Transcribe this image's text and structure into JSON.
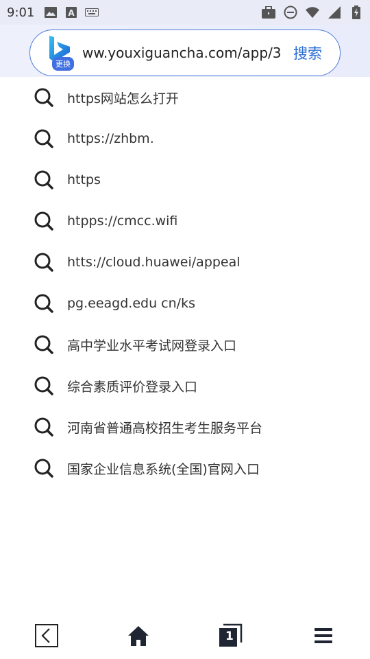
{
  "status_bar": {
    "time": "9:01",
    "left_icons": [
      "image-icon",
      "font-icon",
      "keyboard-icon"
    ],
    "right_icons": [
      "briefcase-icon",
      "do-not-disturb-icon",
      "wifi-icon",
      "signal-icon",
      "battery-charging-icon"
    ]
  },
  "search": {
    "engine_badge": "更换",
    "url": "ww.youxiguancha.com/app/3",
    "button_label": "搜索"
  },
  "suggestions": [
    {
      "label": "https网站怎么打开"
    },
    {
      "label": "https://zhbm."
    },
    {
      "label": "https"
    },
    {
      "label": "htpps://cmcc.wifi"
    },
    {
      "label": "htts://cloud.huawei/appeal"
    },
    {
      "label": "pg.eeagd.edu cn/ks"
    },
    {
      "label": "高中学业水平考试网登录入口"
    },
    {
      "label": "综合素质评价登录入口"
    },
    {
      "label": "河南省普通高校招生考生服务平台"
    },
    {
      "label": "国家企业信息系统(全国)官网入口"
    }
  ],
  "bottom_nav": {
    "tab_count": "1"
  },
  "colors": {
    "accent": "#2c6ed6",
    "status_bg": "#e9ecf6",
    "badge": "#3f6fe0"
  }
}
